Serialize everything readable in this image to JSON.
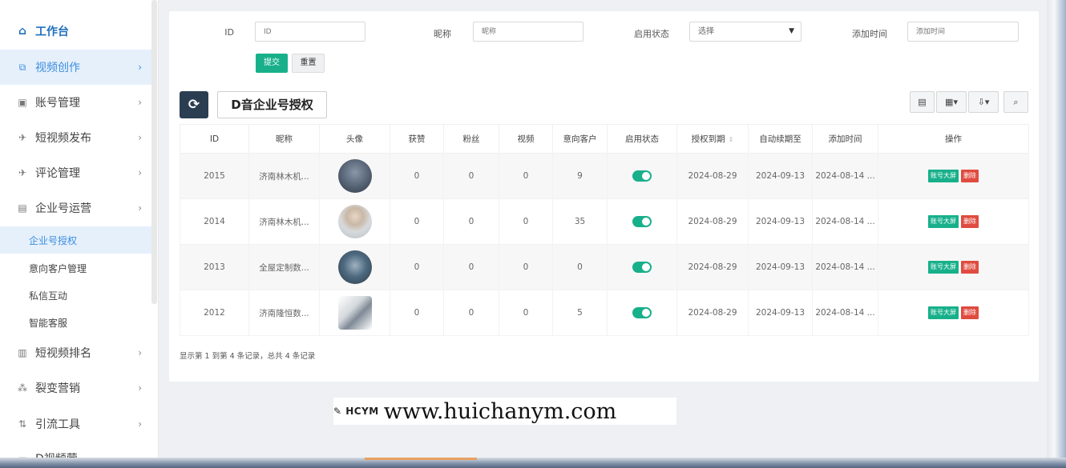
{
  "sidebar": {
    "home": "工作台",
    "items": [
      {
        "label": "视频创作",
        "icon": "video-icon",
        "glyph": "⧉"
      },
      {
        "label": "账号管理",
        "icon": "account-icon",
        "glyph": "▣"
      },
      {
        "label": "短视频发布",
        "icon": "send-icon",
        "glyph": "✈"
      },
      {
        "label": "评论管理",
        "icon": "comment-icon",
        "glyph": "✈"
      },
      {
        "label": "企业号运营",
        "icon": "enterprise-icon",
        "glyph": "▤"
      }
    ],
    "subitems": [
      "企业号授权",
      "意向客户管理",
      "私信互动",
      "智能客服"
    ],
    "items2": [
      {
        "label": "短视频排名",
        "icon": "bar-chart-icon",
        "glyph": "▥"
      },
      {
        "label": "裂变营销",
        "icon": "sitemap-icon",
        "glyph": "⁂"
      },
      {
        "label": "引流工具",
        "icon": "flow-icon",
        "glyph": "⇅"
      }
    ],
    "partial": "D视频营..."
  },
  "filters": {
    "id_label": "ID",
    "id_placeholder": "ID",
    "nick_label": "昵称",
    "nick_placeholder": "昵称",
    "status_label": "启用状态",
    "status_value": "选择",
    "addtime_label": "添加时间",
    "addtime_placeholder": "添加时间",
    "submit": "提交",
    "reset": "重置"
  },
  "page_title": "D音企业号授权",
  "toolbar": {
    "columns_caret": "▾",
    "export_caret": "▾"
  },
  "table": {
    "headers": [
      "ID",
      "昵称",
      "头像",
      "获赞",
      "粉丝",
      "视频",
      "意向客户",
      "启用状态",
      "授权到期",
      "自动续期至",
      "添加时间",
      "操作"
    ],
    "rows": [
      {
        "id": "2015",
        "nick": "济南林木机...",
        "likes": "0",
        "fans": "0",
        "videos": "0",
        "leads": "9",
        "expire": "2024-08-29",
        "renew": "2024-09-13",
        "added": "2024-08-14 ..."
      },
      {
        "id": "2014",
        "nick": "济南林木机...",
        "likes": "0",
        "fans": "0",
        "videos": "0",
        "leads": "35",
        "expire": "2024-08-29",
        "renew": "2024-09-13",
        "added": "2024-08-14 ..."
      },
      {
        "id": "2013",
        "nick": "全屋定制数...",
        "likes": "0",
        "fans": "0",
        "videos": "0",
        "leads": "0",
        "expire": "2024-08-29",
        "renew": "2024-09-13",
        "added": "2024-08-14 ..."
      },
      {
        "id": "2012",
        "nick": "济南隆恒数...",
        "likes": "0",
        "fans": "0",
        "videos": "0",
        "leads": "5",
        "expire": "2024-08-29",
        "renew": "2024-09-13",
        "added": "2024-08-14 ..."
      }
    ],
    "op_primary": "账号大屏",
    "op_delete": "删除"
  },
  "footer": "显示第 1 到第 4 条记录，总共 4 条记录",
  "watermark": {
    "logo": "HCYM",
    "url": "www.huichanym.com"
  },
  "colors": {
    "accent": "#18b08b",
    "danger": "#e04b3f",
    "nav_active": "#3b8ee0",
    "dark_button": "#2b3e51"
  }
}
